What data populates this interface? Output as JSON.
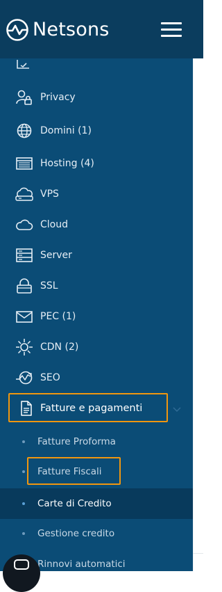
{
  "header": {
    "brand": "Netsons",
    "logo_icon": "netsons-logo-icon",
    "menu_icon": "hamburger-menu-icon",
    "bg_color": "#0b3d5e"
  },
  "sidebar": {
    "bg_color": "#0b4c76",
    "items": [
      {
        "label": "Privacy",
        "icon": "user-lock-icon"
      },
      {
        "label": "Domini (1)",
        "icon": "globe-icon"
      },
      {
        "label": "Hosting (4)",
        "icon": "browser-window-icon"
      },
      {
        "label": "VPS",
        "icon": "cloud-server-icon"
      },
      {
        "label": "Cloud",
        "icon": "cloud-icon"
      },
      {
        "label": "Server",
        "icon": "server-icon"
      },
      {
        "label": "SSL",
        "icon": "lock-icon"
      },
      {
        "label": "PEC (1)",
        "icon": "envelope-icon"
      },
      {
        "label": "CDN (2)",
        "icon": "network-sun-icon"
      },
      {
        "label": "SEO",
        "icon": "seo-chart-icon"
      }
    ],
    "active_section": {
      "label": "Fatture e pagamenti",
      "icon": "document-icon",
      "highlight_color": "#f0960f",
      "expanded_icon": "chevron-down-icon"
    },
    "sub_items": [
      {
        "label": "Fatture Proforma"
      },
      {
        "label": "Fatture Fiscali"
      },
      {
        "label": "Carte di Credito"
      },
      {
        "label": "Gestione credito"
      },
      {
        "label": "Rinnovi automatici"
      }
    ],
    "selected_sub_item": "Carte di Credito"
  },
  "chat": {
    "icon": "chat-icon"
  }
}
